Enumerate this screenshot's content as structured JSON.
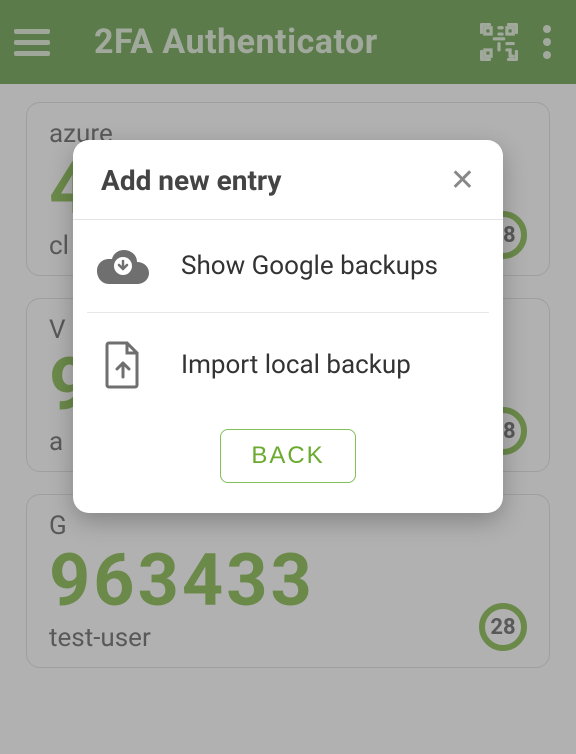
{
  "header": {
    "title": "2FA Authenticator"
  },
  "entries": [
    {
      "issuer": "azure",
      "code": "4",
      "user": "cl",
      "timer": "28"
    },
    {
      "issuer": "V",
      "code": "9",
      "user": "a",
      "timer": "28"
    },
    {
      "issuer": "G",
      "code": "963433",
      "user": "test-user",
      "timer": "28"
    }
  ],
  "dialog": {
    "title": "Add new entry",
    "option_google": "Show Google backups",
    "option_local": "Import local backup",
    "back": "BACK"
  },
  "colors": {
    "primary": "#3b7e16",
    "accent": "#5ba012"
  }
}
